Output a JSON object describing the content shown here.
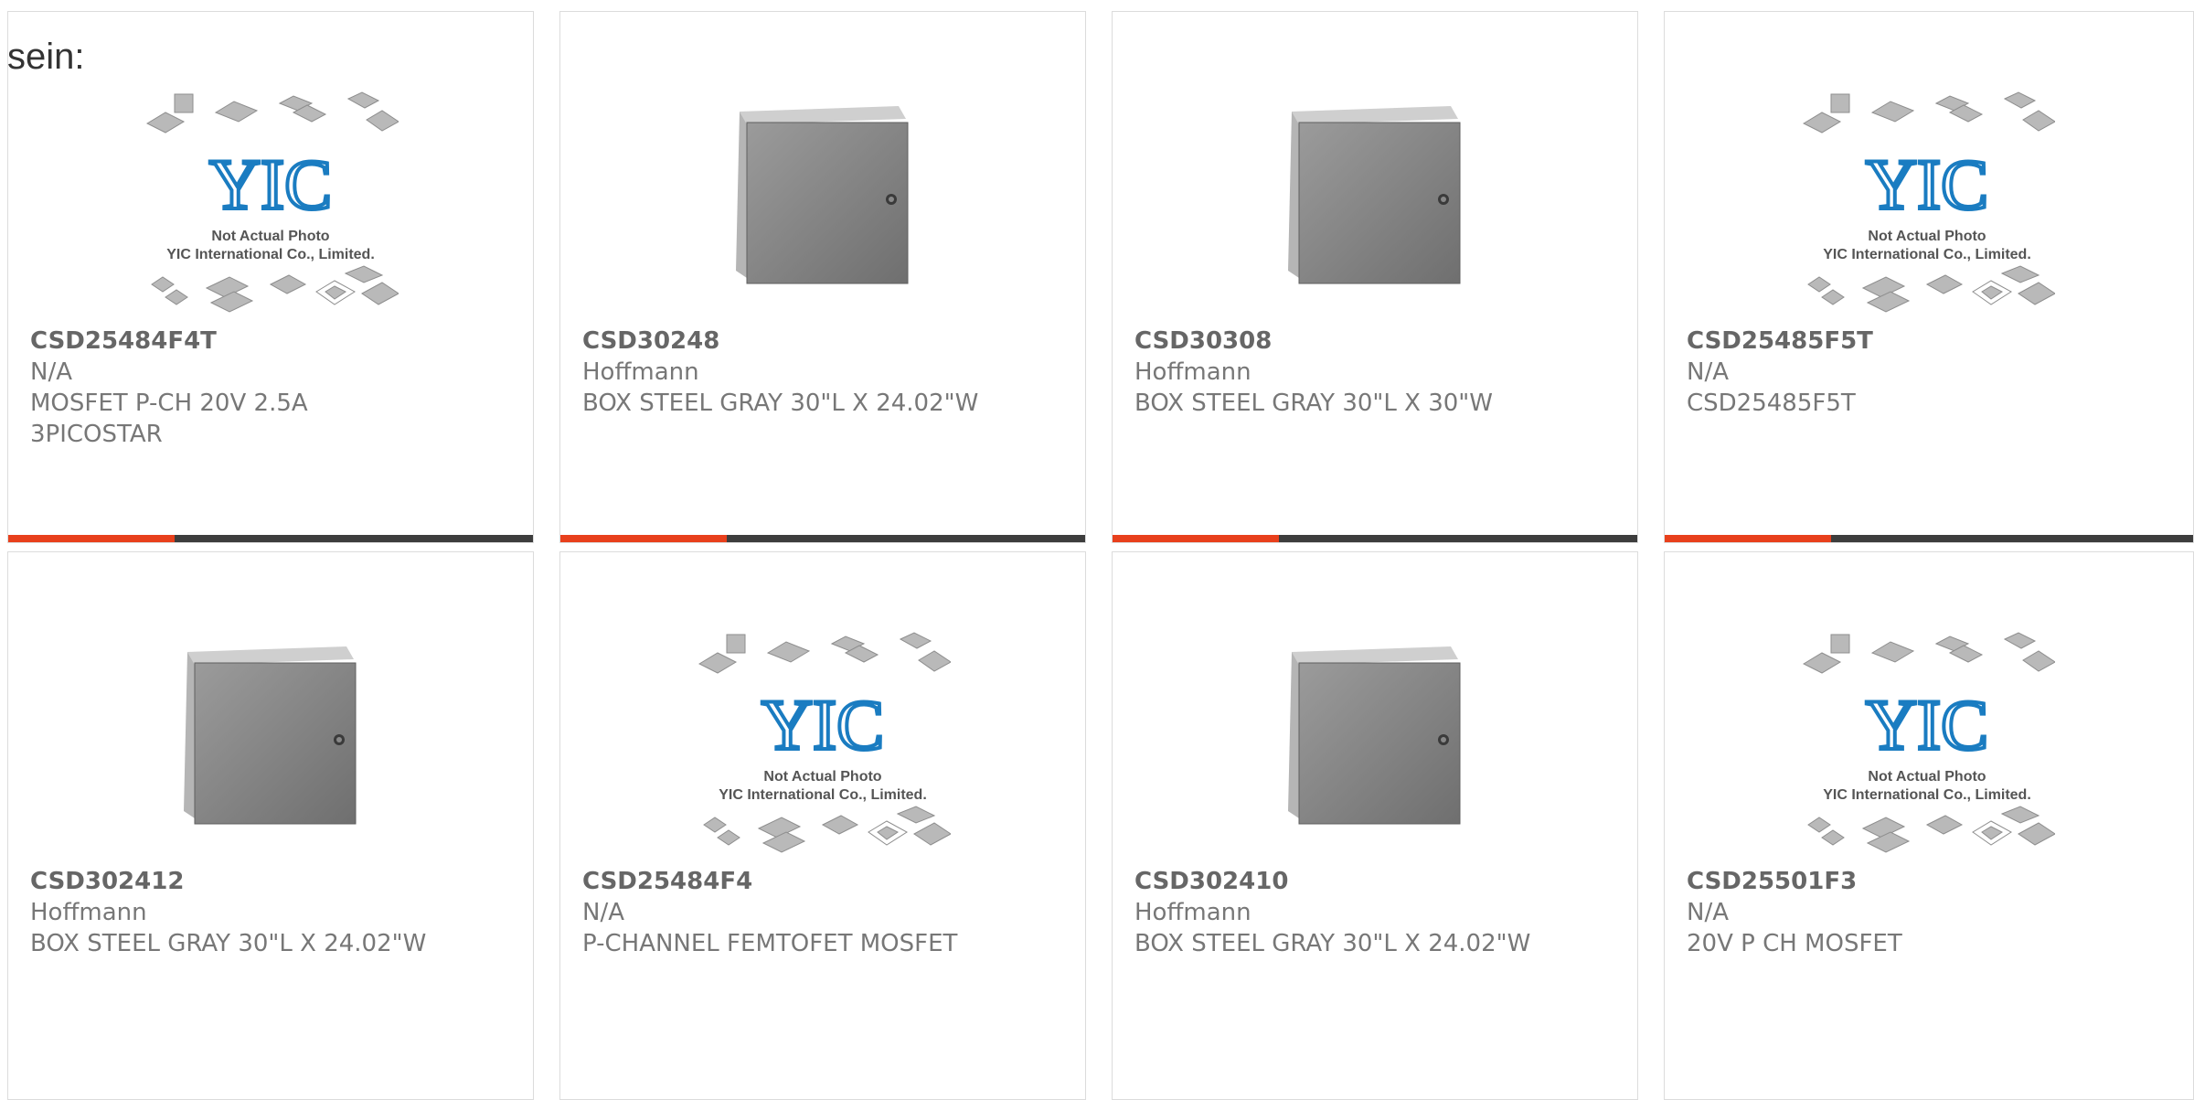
{
  "intro_text": "sein:",
  "colors": {
    "accent": "#e8401c",
    "bar": "#3d3d3d",
    "text": "#777777",
    "logo": "#1a7cc1"
  },
  "placeholder": {
    "line1": "Not Actual Photo",
    "line2": "YIC International Co., Limited.",
    "logo": "YIC"
  },
  "products": [
    {
      "part": "CSD25484F4T",
      "maker": "N/A",
      "desc1": "MOSFET P-CH 20V 2.5A",
      "desc2": "3PICOSTAR",
      "image": "placeholder"
    },
    {
      "part": "CSD30248",
      "maker": "Hoffmann",
      "desc1": "BOX STEEL GRAY 30\"L X 24.02\"W",
      "desc2": "",
      "image": "enclosure"
    },
    {
      "part": "CSD30308",
      "maker": "Hoffmann",
      "desc1": "BOX STEEL GRAY 30\"L X 30\"W",
      "desc2": "",
      "image": "enclosure"
    },
    {
      "part": "CSD25485F5T",
      "maker": "N/A",
      "desc1": "CSD25485F5T",
      "desc2": "",
      "image": "placeholder"
    },
    {
      "part": "CSD302412",
      "maker": "Hoffmann",
      "desc1": "BOX STEEL GRAY 30\"L X 24.02\"W",
      "desc2": "",
      "image": "enclosure"
    },
    {
      "part": "CSD25484F4",
      "maker": "N/A",
      "desc1": "P-CHANNEL FEMTOFET MOSFET",
      "desc2": "",
      "image": "placeholder"
    },
    {
      "part": "CSD302410",
      "maker": "Hoffmann",
      "desc1": "BOX STEEL GRAY 30\"L X 24.02\"W",
      "desc2": "",
      "image": "enclosure"
    },
    {
      "part": "CSD25501F3",
      "maker": "N/A",
      "desc1": "20V P CH MOSFET",
      "desc2": "",
      "image": "placeholder"
    }
  ]
}
